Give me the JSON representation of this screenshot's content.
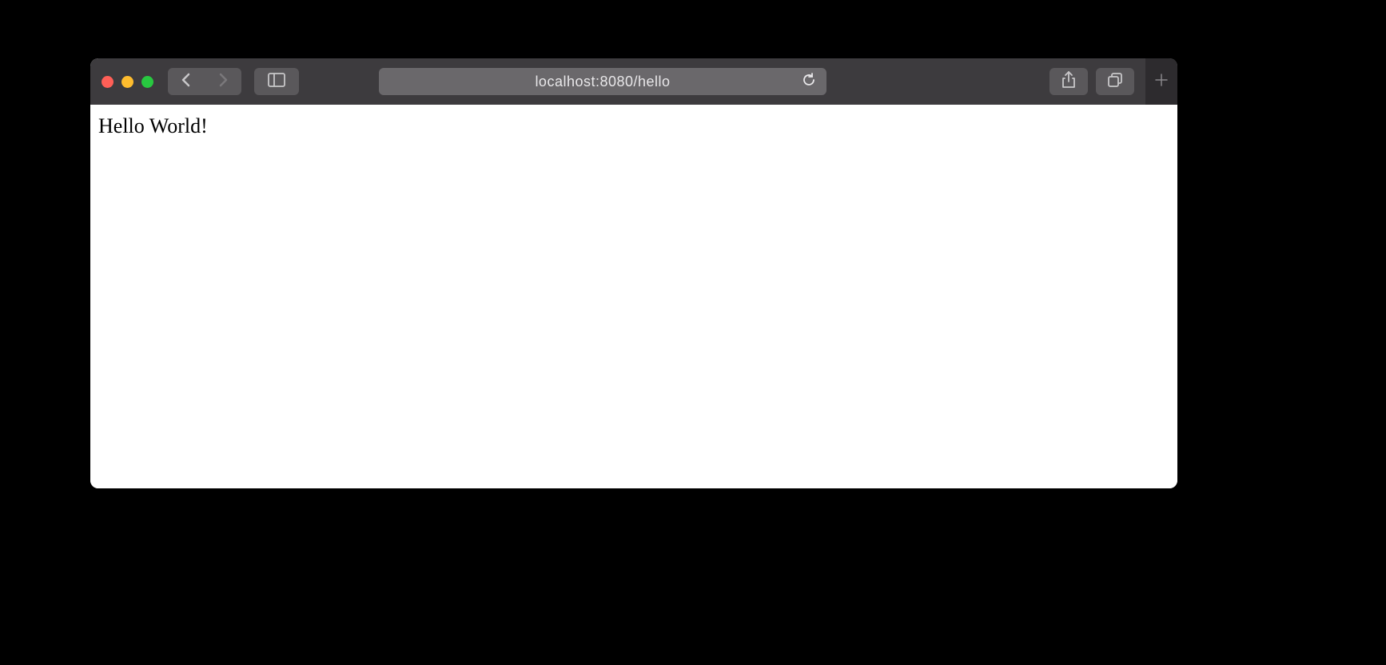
{
  "toolbar": {
    "address": "localhost:8080/hello"
  },
  "page": {
    "body_text": "Hello World!"
  }
}
